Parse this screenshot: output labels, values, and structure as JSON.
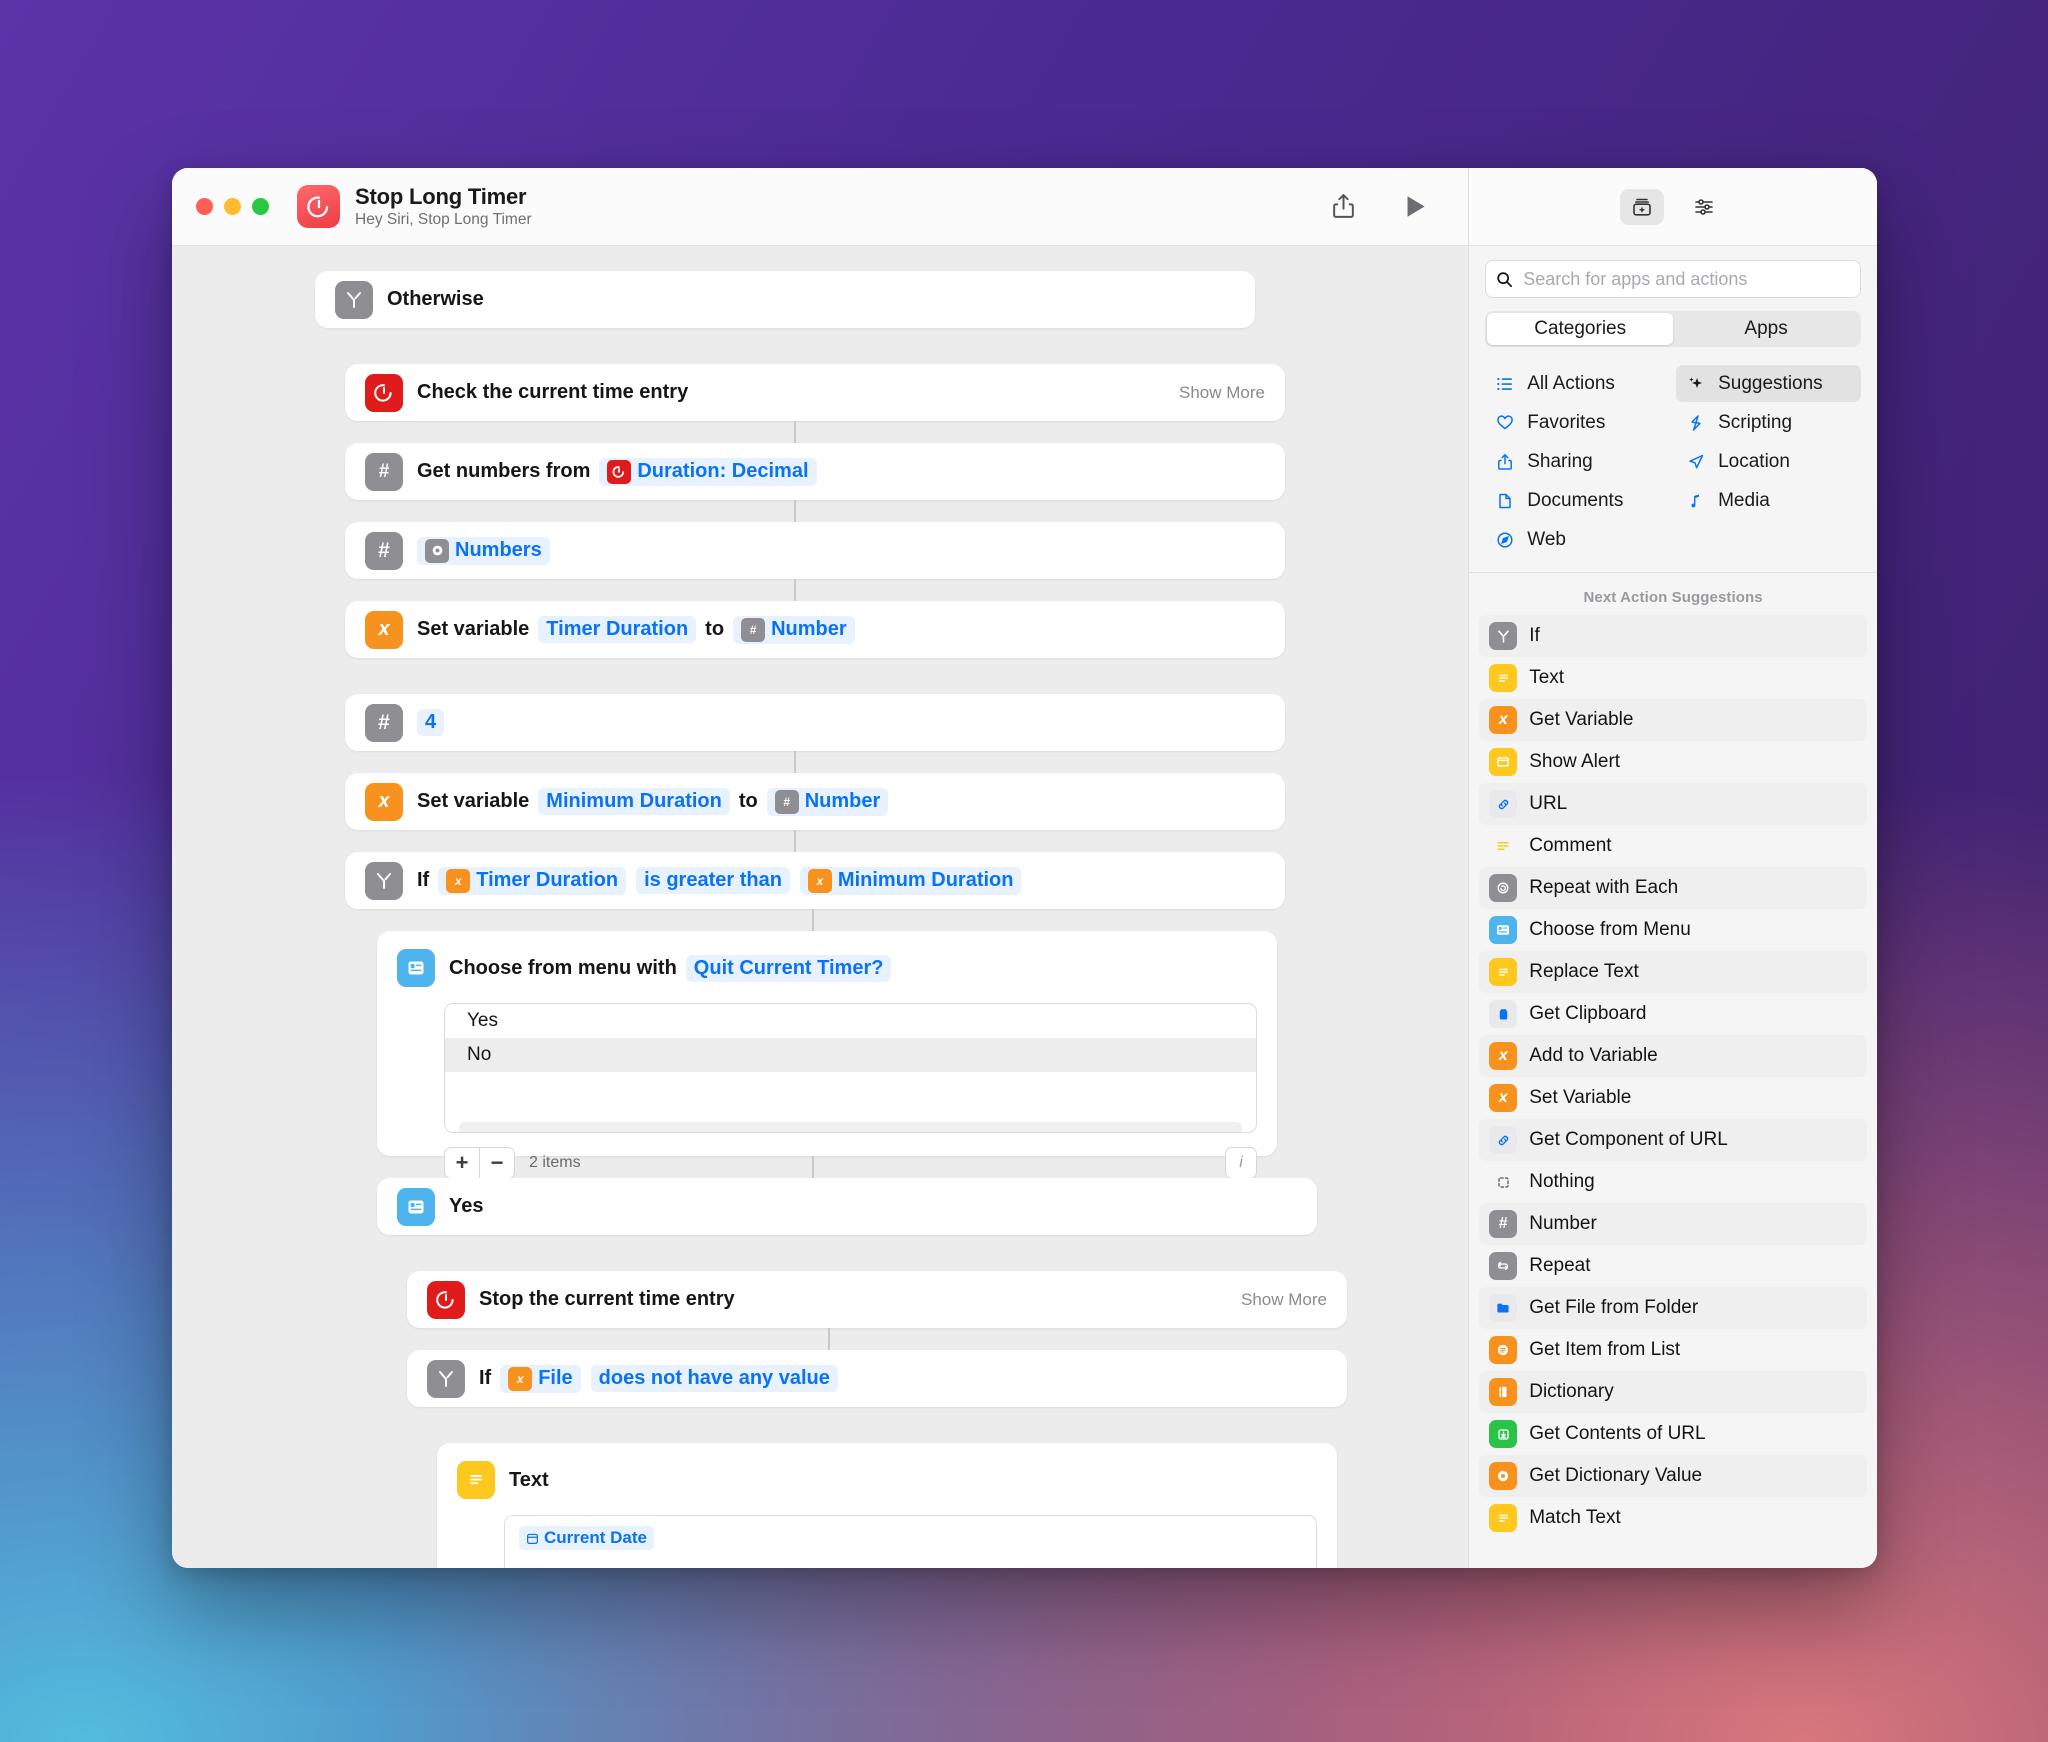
{
  "window": {
    "title": "Stop Long Timer",
    "subtitle": "Hey Siri, Stop Long Timer",
    "app_icon": "stopwatch-icon",
    "traffic_lights": [
      "close",
      "minimize",
      "zoom"
    ],
    "toolbar": {
      "share_label": "share-icon",
      "run_label": "play-icon"
    }
  },
  "workflow": {
    "actions": [
      {
        "id": "otherwise",
        "icon": "if-branch-icon",
        "icon_color": "#8e8e93",
        "label": "Otherwise"
      },
      {
        "id": "check-time-entry",
        "icon": "toggl-timer-icon",
        "icon_color": "#e01b1b",
        "label": "Check the current time entry",
        "show_more": "Show More"
      },
      {
        "id": "get-numbers",
        "icon": "number-icon",
        "icon_color": "#8e8e93",
        "label": "Get numbers from",
        "token": "Duration: Decimal",
        "token_icon": "toggl-timer-icon"
      },
      {
        "id": "numbers-result",
        "icon": "number-icon",
        "icon_color": "#8e8e93",
        "token": "Numbers",
        "token_icon": "magic-variable-icon"
      },
      {
        "id": "set-timer-duration",
        "icon": "variable-icon",
        "icon_color": "#f7921e",
        "label": "Set variable",
        "token": "Timer Duration",
        "joiner": "to",
        "token2": "Number",
        "token2_icon": "number-icon"
      },
      {
        "id": "number-four",
        "icon": "number-icon",
        "icon_color": "#8e8e93",
        "value": "4"
      },
      {
        "id": "set-minimum-duration",
        "icon": "variable-icon",
        "icon_color": "#f7921e",
        "label": "Set variable",
        "token": "Minimum Duration",
        "joiner": "to",
        "token2": "Number",
        "token2_icon": "number-icon"
      },
      {
        "id": "if-duration",
        "icon": "if-branch-icon",
        "icon_color": "#8e8e93",
        "label": "If",
        "token": "Timer Duration",
        "token_icon": "variable-icon",
        "condition": "is greater than",
        "token2": "Minimum Duration",
        "token2_icon": "variable-icon"
      },
      {
        "id": "choose-from-menu",
        "icon": "choose-menu-icon",
        "icon_color": "#4db4ee",
        "label": "Choose from menu with",
        "token": "Quit Current Timer?",
        "menu_items": [
          "Yes",
          "No"
        ],
        "selected_item": "No",
        "add_label": "+",
        "remove_label": "−",
        "count_label": "2 items",
        "info_label": "i"
      },
      {
        "id": "menu-case-yes",
        "icon": "choose-menu-icon",
        "icon_color": "#4db4ee",
        "label": "Yes"
      },
      {
        "id": "stop-time-entry",
        "icon": "toggl-timer-icon",
        "icon_color": "#e01b1b",
        "label": "Stop the current time entry",
        "show_more": "Show More"
      },
      {
        "id": "if-file",
        "icon": "if-branch-icon",
        "icon_color": "#8e8e93",
        "label": "If",
        "token": "File",
        "token_icon": "variable-icon",
        "condition": "does not have any value"
      },
      {
        "id": "text-action",
        "icon": "text-icon",
        "icon_color": "#ffc81f",
        "label": "Text",
        "field_token": "Current Date",
        "field_token_icon": "date-icon"
      }
    ]
  },
  "library": {
    "header_buttons": [
      {
        "name": "action-library-icon",
        "active": true
      },
      {
        "name": "sliders-icon",
        "active": false
      }
    ],
    "search": {
      "placeholder": "Search for apps and actions",
      "value": "",
      "icon": "search-icon"
    },
    "segmented": {
      "options": [
        "Categories",
        "Apps"
      ],
      "selected": "Categories"
    },
    "categories": [
      {
        "label": "All Actions",
        "icon": "list-bullet-icon",
        "selected": false
      },
      {
        "label": "Suggestions",
        "icon": "sparkles-icon",
        "selected": true
      },
      {
        "label": "Favorites",
        "icon": "heart-icon",
        "selected": false
      },
      {
        "label": "Scripting",
        "icon": "scripting-icon",
        "selected": false
      },
      {
        "label": "Sharing",
        "icon": "share-icon",
        "selected": false
      },
      {
        "label": "Location",
        "icon": "location-arrow-icon",
        "selected": false
      },
      {
        "label": "Documents",
        "icon": "document-icon",
        "selected": false
      },
      {
        "label": "Media",
        "icon": "music-note-icon",
        "selected": false
      },
      {
        "label": "Web",
        "icon": "safari-compass-icon",
        "selected": false
      }
    ],
    "suggestions_title": "Next Action Suggestions",
    "suggestions": [
      {
        "label": "If",
        "icon": "if-branch-icon",
        "color": "#8e8e93"
      },
      {
        "label": "Text",
        "icon": "text-icon",
        "color": "#ffc81f"
      },
      {
        "label": "Get Variable",
        "icon": "variable-icon",
        "color": "#f7921e"
      },
      {
        "label": "Show Alert",
        "icon": "alert-window-icon",
        "color": "#ffc81f"
      },
      {
        "label": "URL",
        "icon": "link-icon",
        "color": "#e9e9ec"
      },
      {
        "label": "Comment",
        "icon": "comment-lines-icon",
        "color": "transparent"
      },
      {
        "label": "Repeat with Each",
        "icon": "repeat-each-icon",
        "color": "#8e8e93"
      },
      {
        "label": "Choose from Menu",
        "icon": "choose-menu-icon",
        "color": "#4db4ee"
      },
      {
        "label": "Replace Text",
        "icon": "text-icon",
        "color": "#ffc81f"
      },
      {
        "label": "Get Clipboard",
        "icon": "clipboard-icon",
        "color": "#e9e9ec"
      },
      {
        "label": "Add to Variable",
        "icon": "variable-icon",
        "color": "#f7921e"
      },
      {
        "label": "Set Variable",
        "icon": "variable-icon",
        "color": "#f7921e"
      },
      {
        "label": "Get Component of URL",
        "icon": "link-icon",
        "color": "#e9e9ec"
      },
      {
        "label": "Nothing",
        "icon": "nothing-dashed-icon",
        "color": "transparent"
      },
      {
        "label": "Number",
        "icon": "number-icon",
        "color": "#8e8e93"
      },
      {
        "label": "Repeat",
        "icon": "repeat-icon",
        "color": "#8e8e93"
      },
      {
        "label": "Get File from Folder",
        "icon": "folder-icon",
        "color": "#e9e9ec"
      },
      {
        "label": "Get Item from List",
        "icon": "list-circle-icon",
        "color": "#f7921e"
      },
      {
        "label": "Dictionary",
        "icon": "dictionary-icon",
        "color": "#f7921e"
      },
      {
        "label": "Get Contents of URL",
        "icon": "download-icon",
        "color": "#2bc24a"
      },
      {
        "label": "Get Dictionary Value",
        "icon": "dictionary-value-icon",
        "color": "#f7921e"
      },
      {
        "label": "Match Text",
        "icon": "text-icon",
        "color": "#ffc81f"
      }
    ]
  }
}
